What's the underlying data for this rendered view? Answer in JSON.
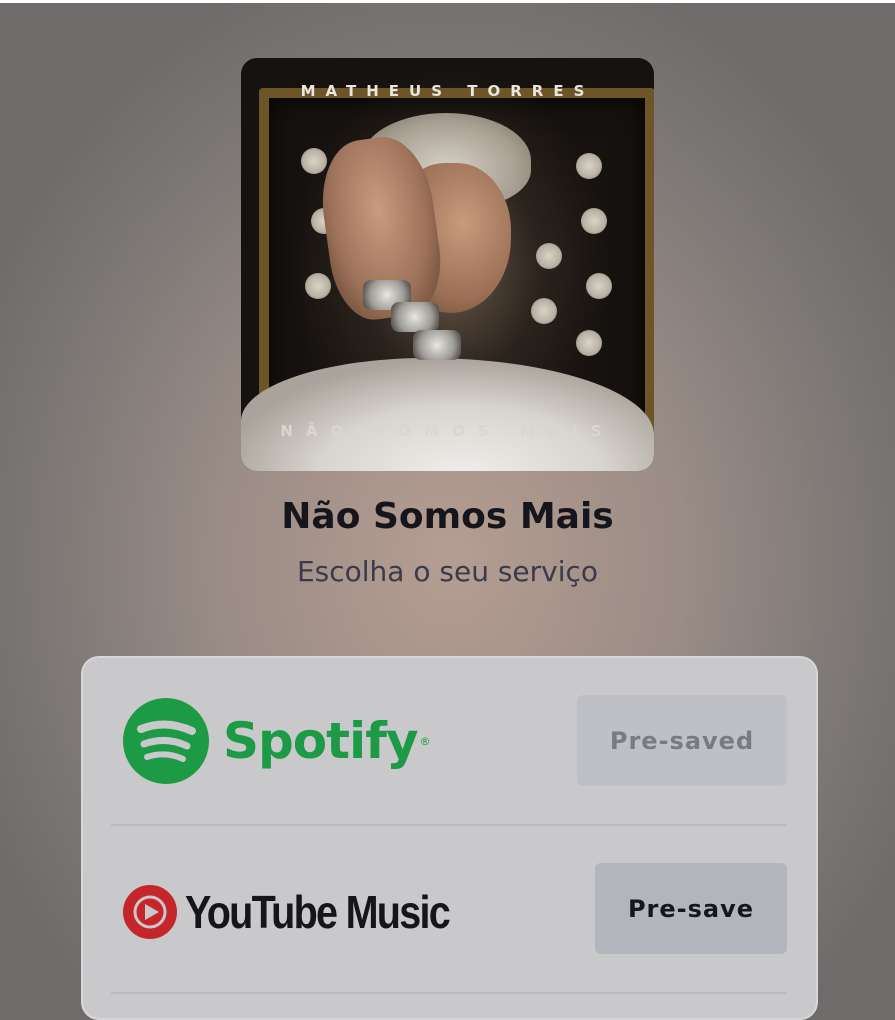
{
  "album": {
    "artist_on_cover": "MATHEUS TORRES",
    "title_on_cover": "NÃO SOMOS MAIS"
  },
  "release": {
    "title": "Não Somos Mais",
    "subtitle": "Escolha o seu serviço"
  },
  "services": [
    {
      "name": "Spotify",
      "button_label": "Pre-saved",
      "brand_color": "#1DB954",
      "icon": "spotify-icon"
    },
    {
      "name": "YouTube Music",
      "button_label": "Pre-save",
      "brand_color": "#E52D27",
      "icon": "youtube-music-icon"
    }
  ]
}
